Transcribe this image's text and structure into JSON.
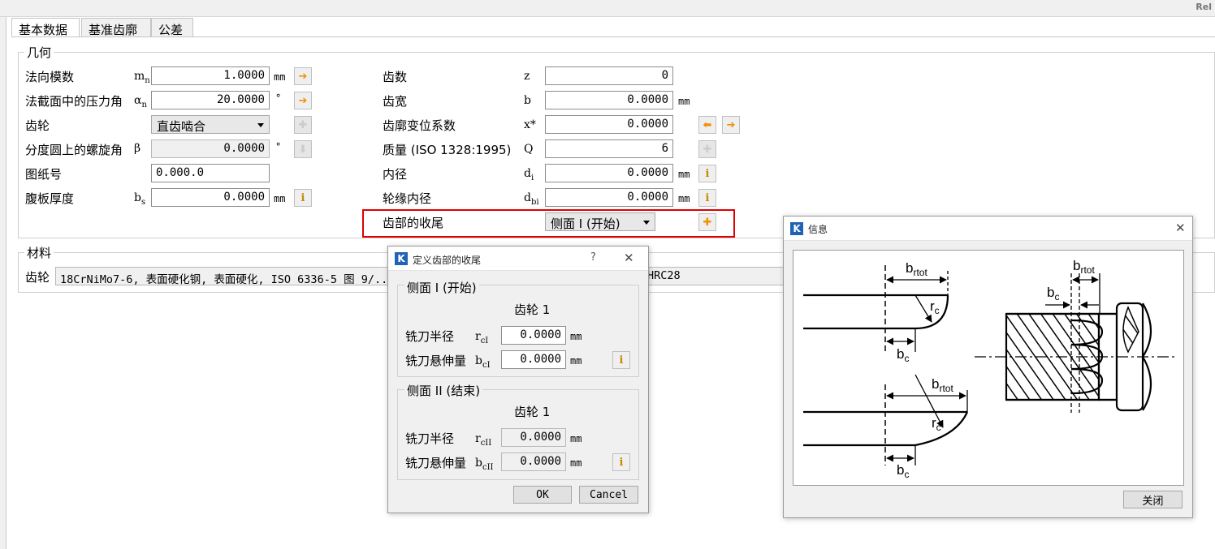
{
  "app": {
    "corner_text": "Rel"
  },
  "tabs": [
    "基本数据",
    "基准齿廓",
    "公差"
  ],
  "geometry": {
    "title": "几何",
    "left_rows": [
      {
        "label": "法向模数",
        "sym": "m",
        "sub": "n",
        "value": "1.0000",
        "unit": "mm"
      },
      {
        "label": "法截面中的压力角",
        "sym": "α",
        "sub": "n",
        "value": "20.0000",
        "unit": "°"
      },
      {
        "label": "齿轮",
        "combo": "直齿啮合"
      },
      {
        "label": "分度圆上的螺旋角",
        "sym": "β",
        "value": "0.0000",
        "unit": "°"
      },
      {
        "label": "图纸号",
        "value": "0.000.0"
      },
      {
        "label": "腹板厚度",
        "sym": "b",
        "sub": "s",
        "value": "0.0000",
        "unit": "mm"
      }
    ],
    "right_rows": [
      {
        "label": "齿数",
        "sym": "z",
        "value": "0"
      },
      {
        "label": "齿宽",
        "sym": "b",
        "value": "0.0000",
        "unit": "mm"
      },
      {
        "label": "齿廓变位系数",
        "sym": "x*",
        "value": "0.0000"
      },
      {
        "label": "质量 (ISO 1328:1995)",
        "sym": "Q",
        "value": "6"
      },
      {
        "label": "内径",
        "sym": "d",
        "sub": "i",
        "value": "0.0000",
        "unit": "mm"
      },
      {
        "label": "轮缘内径",
        "sym": "d",
        "sub": "bi",
        "value": "0.0000",
        "unit": "mm"
      },
      {
        "label": "齿部的收尾",
        "combo": "侧面 I (开始)"
      }
    ]
  },
  "material": {
    "title": "材料",
    "label": "齿轮",
    "value": "18CrNiMo7-6, 表面硬化钢, 表面硬化, ISO 6336-5 图 9/...",
    "tail": "HRC28"
  },
  "dialog_end": {
    "title": "定义齿部的收尾",
    "help": "?",
    "close": "✕",
    "s1": {
      "title": "侧面 I (开始)",
      "gear": "齿轮 1",
      "r_label": "铣刀半径",
      "r_sym": "r",
      "r_sub": "cI",
      "r_val": "0.0000",
      "r_unit": "mm",
      "b_label": "铣刀悬伸量",
      "b_sym": "b",
      "b_sub": "cI",
      "b_val": "0.0000",
      "b_unit": "mm"
    },
    "s2": {
      "title": "侧面 II (结束)",
      "gear": "齿轮 1",
      "r_label": "铣刀半径",
      "r_sym": "r",
      "r_sub": "cII",
      "r_val": "0.0000",
      "r_unit": "mm",
      "b_label": "铣刀悬伸量",
      "b_sym": "b",
      "b_sub": "cII",
      "b_val": "0.0000",
      "b_unit": "mm"
    },
    "ok": "OK",
    "cancel": "Cancel"
  },
  "info_dialog": {
    "title": "信息",
    "close": "✕",
    "close_button": "关闭",
    "diagram": {
      "b": "b",
      "rtot": "rtot",
      "c": "c",
      "r": "r"
    }
  },
  "colors": {
    "highlight": "#e00000",
    "accent": "#f29000",
    "logo": "#1f63b5"
  },
  "icons": [
    "transfer-right-icon",
    "transfer-left-icon",
    "plus-icon",
    "info-icon",
    "close-icon",
    "help-icon",
    "dropdown-arrow-icon"
  ]
}
